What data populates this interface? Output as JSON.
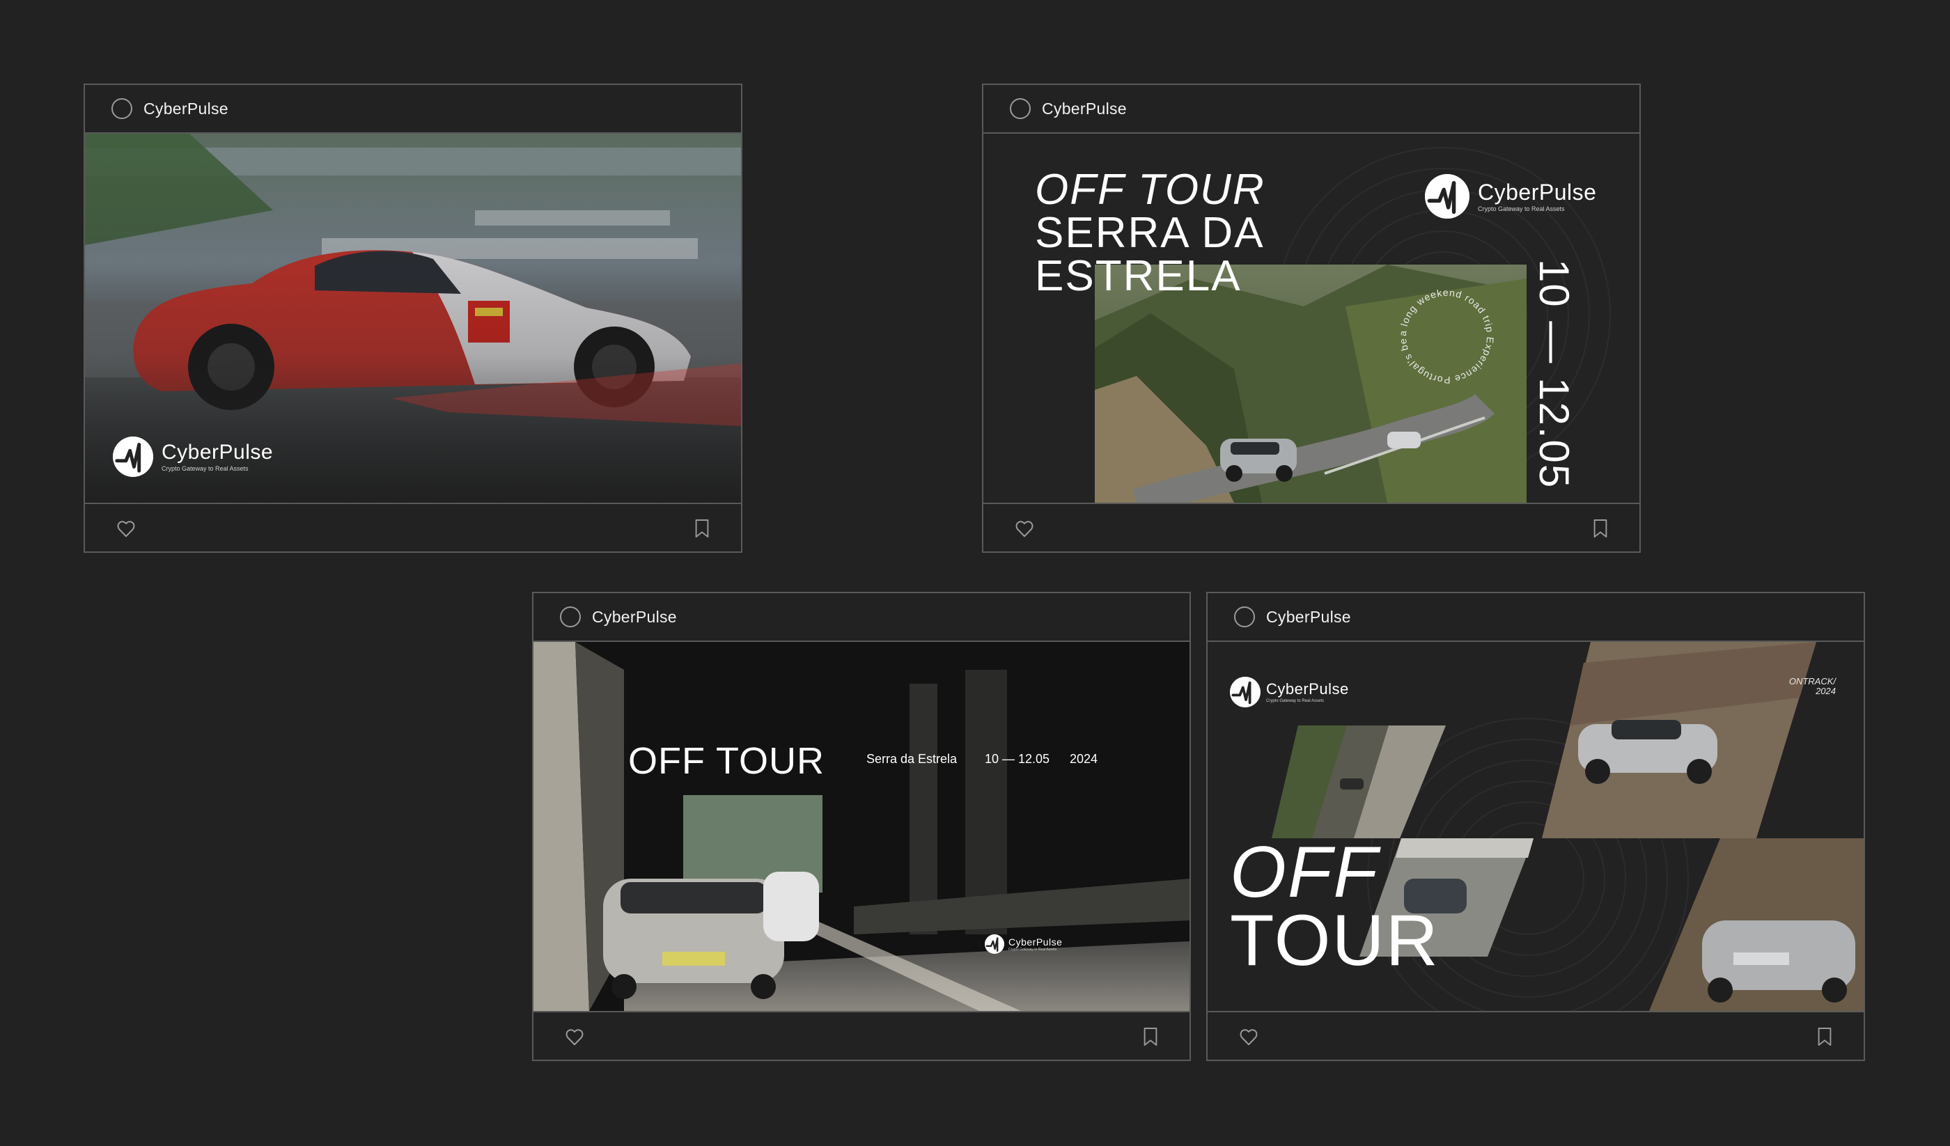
{
  "brand": {
    "name": "CyberPulse",
    "tagline": "Crypto Gateway to Real Assets"
  },
  "posts": [
    {
      "account": "CyberPulse",
      "image_text": {}
    },
    {
      "account": "CyberPulse",
      "image_text": {
        "title_line1": "OFF TOUR",
        "title_line2": "SERRA DA",
        "title_line3": "ESTRELA",
        "dates": "10 — 12.05",
        "circle_text": "a long weekend road trip Experience Portugal's beauty on"
      }
    },
    {
      "account": "CyberPulse",
      "image_text": {
        "title": "OFF TOUR",
        "location": "Serra da Estrela",
        "dates": "10 — 12.05",
        "year": "2024"
      }
    },
    {
      "account": "CyberPulse",
      "image_text": {
        "title_line1": "OFF",
        "title_line2": "TOUR",
        "corner_line1": "ONTRACK/",
        "corner_line2": "2024"
      }
    }
  ],
  "icons": {
    "like": "heart-icon",
    "save": "bookmark-icon",
    "logo": "pulse-logo-icon"
  },
  "colors": {
    "background": "#222222",
    "border": "#5a5a5a",
    "text": "#ffffff",
    "car_red": "#c8322a"
  }
}
